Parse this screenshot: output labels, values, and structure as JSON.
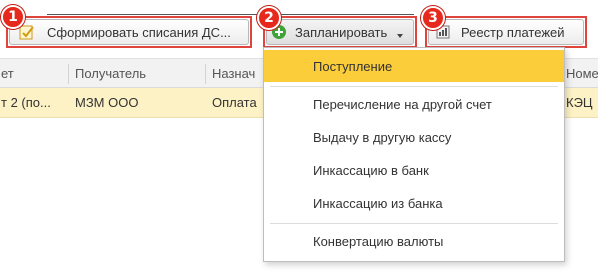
{
  "toolbar": {
    "form_writeoffs_label": "Сформировать списания ДС...",
    "plan_label": "Запланировать",
    "registry_label": "Реестр платежей"
  },
  "badges": [
    "1",
    "2",
    "3"
  ],
  "table": {
    "columns": [
      "ет",
      "Получатель",
      "Назнач",
      "Номе"
    ],
    "rows": [
      [
        "т 2 (по...",
        "МЗМ ООО",
        "Оплата",
        "КЭЦ"
      ]
    ]
  },
  "menu": {
    "items": [
      "Поступление",
      "Перечисление на другой счет",
      "Выдачу в другую кассу",
      "Инкассацию в банк",
      "Инкассацию из банка",
      "Конвертацию валюты"
    ],
    "selected_index": 0
  },
  "colors": {
    "highlight_red": "#e0453d",
    "badge_red": "#e6281d",
    "menu_selected": "#fbcd3a",
    "row_selected": "#fdf2c6",
    "plan_icon_green": "#3fa33a"
  },
  "icons": [
    "document-check-icon",
    "add-circle-icon",
    "chevron-down-icon",
    "registry-icon"
  ]
}
